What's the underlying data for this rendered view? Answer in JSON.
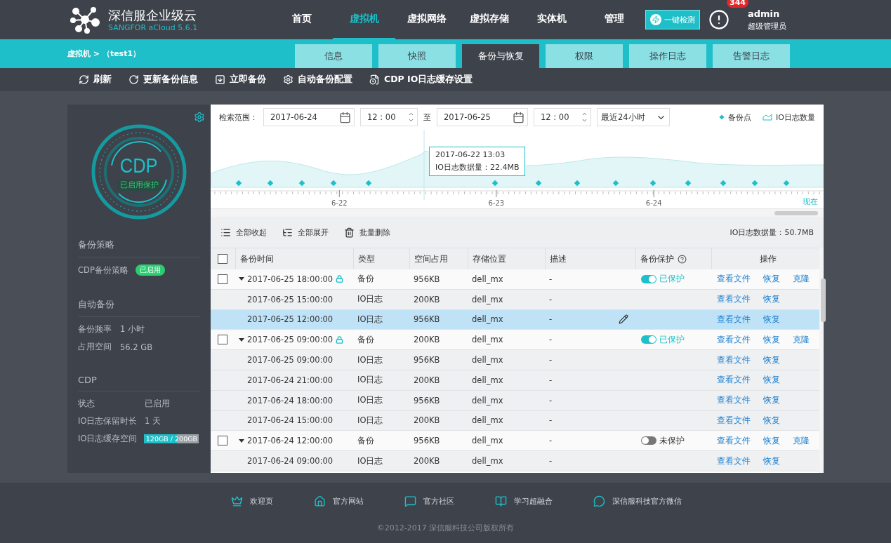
{
  "brand": {
    "title": "深信服企业级云",
    "subtitle": "SANGFOR aCloud 5.6.1"
  },
  "nav": [
    {
      "label": "首页",
      "selected": false
    },
    {
      "label": "虚拟机",
      "selected": true
    },
    {
      "label": "虚拟网络",
      "selected": false
    },
    {
      "label": "虚拟存储",
      "selected": false
    },
    {
      "label": "实体机",
      "selected": false
    },
    {
      "label": "管理",
      "selected": false
    }
  ],
  "check_button": "一键检测",
  "alerts": {
    "count": "344"
  },
  "user": {
    "name": "admin",
    "role": "超级管理员"
  },
  "breadcrumb": "虚拟机 > （test1）",
  "tabs": [
    {
      "label": "信息",
      "selected": false
    },
    {
      "label": "快照",
      "selected": false
    },
    {
      "label": "备份与恢复",
      "selected": true
    },
    {
      "label": "权限",
      "selected": false
    },
    {
      "label": "操作日志",
      "selected": false
    },
    {
      "label": "告警日志",
      "selected": false
    }
  ],
  "toolbar": [
    {
      "kind": "refresh",
      "label": "刷新"
    },
    {
      "kind": "update",
      "label": "更新备份信息"
    },
    {
      "kind": "backup",
      "label": "立即备份"
    },
    {
      "kind": "settings",
      "label": "自动备份配置"
    },
    {
      "kind": "cache",
      "label": "CDP IO日志缓存设置"
    }
  ],
  "side": {
    "badge_title": "CDP",
    "badge_status": "已启用保护",
    "sections": [
      {
        "title": "备份策略",
        "rows": [
          {
            "kind": "tag",
            "label": "CDP备份策略",
            "value": "已启用"
          }
        ]
      },
      {
        "title": "自动备份",
        "rows": [
          {
            "kind": "text",
            "label": "备份频率",
            "value": "1 小时"
          },
          {
            "kind": "text",
            "label": "占用空间",
            "value": "56.2 GB"
          }
        ]
      },
      {
        "title": "CDP",
        "rows": [
          {
            "kind": "text",
            "label": "状态",
            "value": "已启用"
          },
          {
            "kind": "text",
            "label": "IO日志保留时长",
            "value": "1 天"
          },
          {
            "kind": "meter",
            "label": "IO日志缓存空间",
            "value": "120GB / 200GB",
            "level": 0.6
          }
        ]
      }
    ]
  },
  "filter": {
    "label": "检索范围：",
    "from_date": "2017-06-24",
    "from_time": "12 : 00",
    "separator": "至",
    "to_date": "2017-06-25",
    "to_time": "12 : 00",
    "range": "最近24小时",
    "legend": [
      {
        "kind": "point",
        "label": "备份点"
      },
      {
        "kind": "area",
        "label": "IO日志数量"
      }
    ]
  },
  "timeline": {
    "ticks": [
      "6-22",
      "6-23",
      "6-24"
    ],
    "end_label": "现在",
    "tooltip": {
      "time": "2017-06-22 13:03",
      "text": "IO日志数据量：22.4MB"
    }
  },
  "table_tools": [
    {
      "kind": "collapse",
      "label": "全部收起"
    },
    {
      "kind": "expand",
      "label": "全部展开"
    },
    {
      "kind": "delete",
      "label": "批量删除"
    }
  ],
  "io_total": "IO日志数据量：50.7MB",
  "select_all": {
    "checked": false
  },
  "columns": [
    "备份时间",
    "类型",
    "空间占用",
    "存储位置",
    "描述",
    "备份保护",
    "操作"
  ],
  "rows": [
    {
      "kind": "backup",
      "checked": false,
      "expanded": true,
      "locked": true,
      "selected": false,
      "time": "2017-06-25 18:00:00",
      "type": "备份",
      "size": "956KB",
      "location": "dell_mx",
      "desc": "-",
      "protection": {
        "on": true,
        "label": "已保护"
      },
      "actions": [
        "查看文件",
        "恢复",
        "克隆"
      ]
    },
    {
      "kind": "log",
      "selected": false,
      "time": "2017-06-25 15:00:00",
      "type": "IO日志",
      "size": "200KB",
      "location": "dell_mx",
      "desc": "-",
      "actions": [
        "查看文件",
        "恢复"
      ]
    },
    {
      "kind": "log",
      "selected": true,
      "time": "2017-06-25 12:00:00",
      "type": "IO日志",
      "size": "956KB",
      "location": "dell_mx",
      "desc": "-",
      "actions": [
        "查看文件",
        "恢复"
      ]
    },
    {
      "kind": "backup",
      "checked": false,
      "expanded": true,
      "locked": true,
      "selected": false,
      "time": "2017-06-25 09:00:00",
      "type": "备份",
      "size": "200KB",
      "location": "dell_mx",
      "desc": "-",
      "protection": {
        "on": true,
        "label": "已保护"
      },
      "actions": [
        "查看文件",
        "恢复",
        "克隆"
      ]
    },
    {
      "kind": "log",
      "selected": false,
      "time": "2017-06-25 09:00:00",
      "type": "IO日志",
      "size": "956KB",
      "location": "dell_mx",
      "desc": "-",
      "actions": [
        "查看文件",
        "恢复"
      ]
    },
    {
      "kind": "log",
      "selected": false,
      "time": "2017-06-24 21:00:00",
      "type": "IO日志",
      "size": "200KB",
      "location": "dell_mx",
      "desc": "-",
      "actions": [
        "查看文件",
        "恢复"
      ]
    },
    {
      "kind": "log",
      "selected": false,
      "time": "2017-06-24 18:00:00",
      "type": "IO日志",
      "size": "956KB",
      "location": "dell_mx",
      "desc": "-",
      "actions": [
        "查看文件",
        "恢复"
      ]
    },
    {
      "kind": "log",
      "selected": false,
      "time": "2017-06-24 15:00:00",
      "type": "IO日志",
      "size": "200KB",
      "location": "dell_mx",
      "desc": "-",
      "actions": [
        "查看文件",
        "恢复"
      ]
    },
    {
      "kind": "backup",
      "checked": false,
      "expanded": true,
      "locked": false,
      "selected": false,
      "time": "2017-06-24 12:00:00",
      "type": "备份",
      "size": "956KB",
      "location": "dell_mx",
      "desc": "-",
      "protection": {
        "on": false,
        "label": "未保护"
      },
      "actions": [
        "查看文件",
        "恢复",
        "克隆"
      ]
    },
    {
      "kind": "log",
      "selected": false,
      "time": "2017-06-24 09:00:00",
      "type": "IO日志",
      "size": "200KB",
      "location": "dell_mx",
      "desc": "-",
      "actions": [
        "查看文件",
        "恢复"
      ]
    }
  ],
  "footer": {
    "links": [
      {
        "kind": "welcome",
        "label": "欢迎页"
      },
      {
        "kind": "site",
        "label": "官方网站"
      },
      {
        "kind": "community",
        "label": "官方社区"
      },
      {
        "kind": "learn",
        "label": "学习超融合"
      },
      {
        "kind": "wechat",
        "label": "深信服科技官方微信"
      }
    ],
    "copyright": "©2012-2017 深信服科技公司版权所有"
  }
}
